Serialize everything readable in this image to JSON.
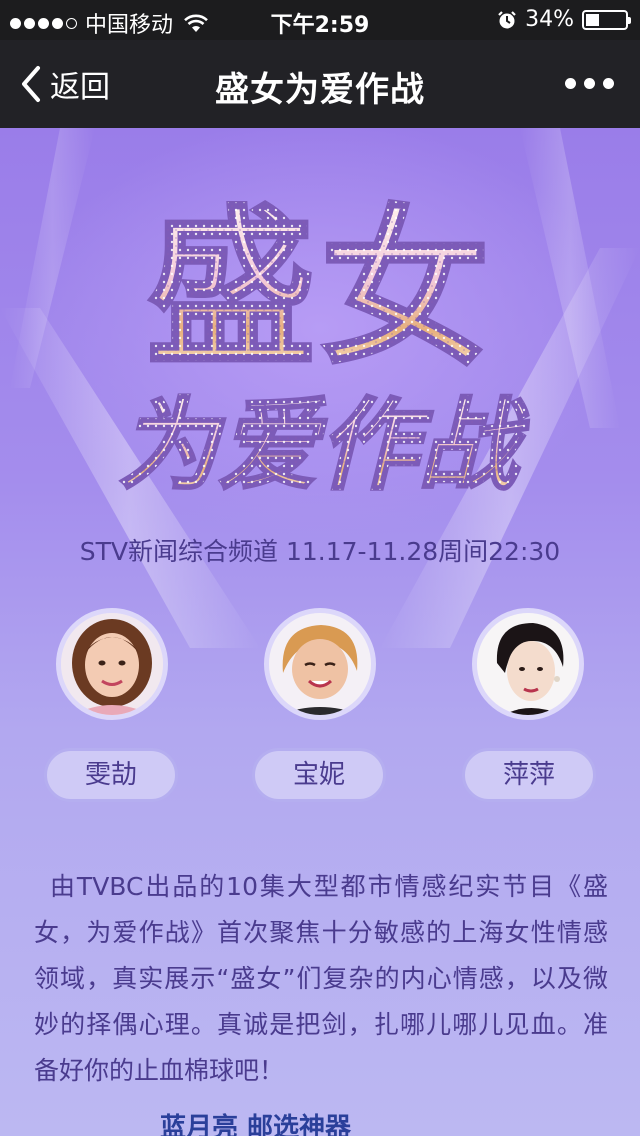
{
  "status_bar": {
    "carrier": "中国移动",
    "time": "下午2:59",
    "battery": "34%",
    "battery_level": 0.34,
    "signal_bars": 4
  },
  "nav": {
    "back_label": "返回",
    "title": "盛女为爱作战"
  },
  "banner": {
    "logo_line1": "盛女",
    "logo_line2": "为爱作战"
  },
  "channel_info": "STV新闻综合频道 11.17-11.28周间22:30",
  "hosts": [
    {
      "name": "雯劼"
    },
    {
      "name": "宝妮"
    },
    {
      "name": "萍萍"
    }
  ],
  "description": "由TVBC出品的10集大型都市情感纪实节目《盛女，为爱作战》首次聚焦十分敏感的上海女性情感领域，真实展示“盛女”们复杂的内心情感，以及微妙的择偶心理。真诚是把剑，扎哪儿哪儿见血。准备好你的止血棉球吧！",
  "bottom_partial": "蓝月亮 邮选神器"
}
